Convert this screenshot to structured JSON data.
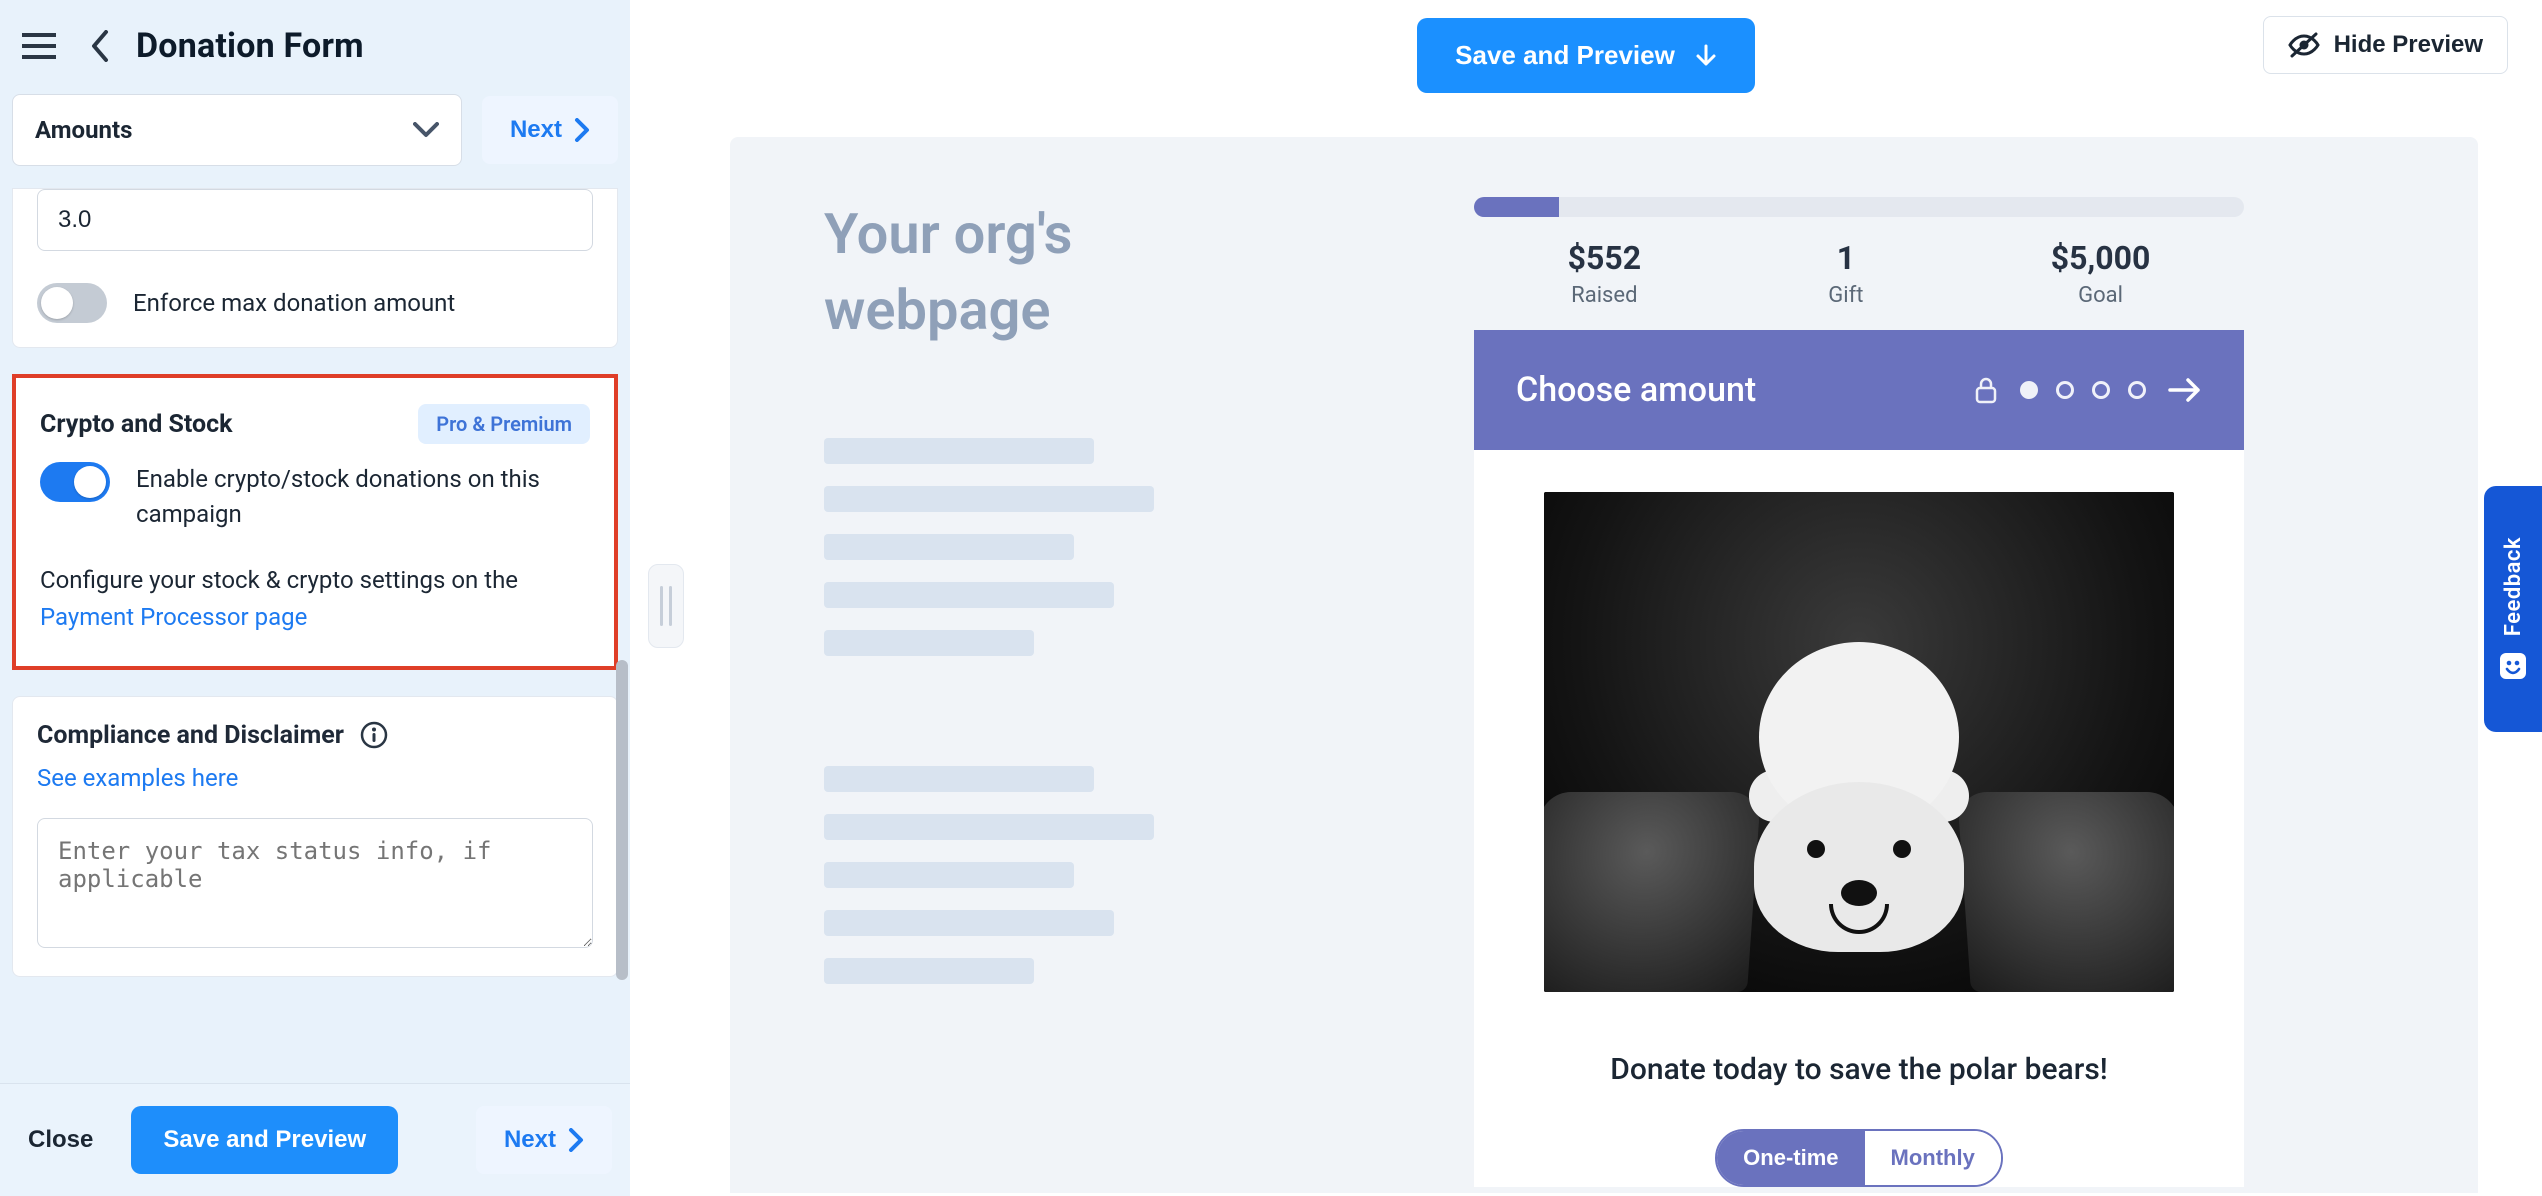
{
  "sidebar": {
    "title": "Donation Form",
    "section_select": {
      "value": "Amounts"
    },
    "next_label": "Next",
    "amount_input": {
      "value": "3.0"
    },
    "enforce_toggle": {
      "on": false,
      "label": "Enforce max donation amount"
    },
    "crypto": {
      "heading": "Crypto and Stock",
      "badge": "Pro & Premium",
      "toggle": {
        "on": true,
        "label": "Enable crypto/stock donations on this campaign"
      },
      "para_pre": "Configure your stock & crypto settings on the ",
      "para_link": "Payment Processor page"
    },
    "compliance": {
      "heading": "Compliance and Disclaimer",
      "examples_link": "See examples here",
      "placeholder": "Enter your tax status info, if applicable"
    },
    "footer": {
      "close": "Close",
      "save_preview": "Save and Preview",
      "next": "Next"
    }
  },
  "topbar": {
    "save_preview": "Save and Preview",
    "hide_preview": "Hide Preview"
  },
  "preview": {
    "mock_title_l1": "Your org's",
    "mock_title_l2": "webpage",
    "stats": {
      "raised_value": "$552",
      "raised_label": "Raised",
      "gift_value": "1",
      "gift_label": "Gift",
      "goal_value": "$5,000",
      "goal_label": "Goal"
    },
    "choose_amount": "Choose amount",
    "tagline": "Donate today to save the polar bears!",
    "freq": {
      "one_time": "One-time",
      "monthly": "Monthly"
    },
    "progress_percent": 11
  },
  "feedback_label": "Feedback"
}
